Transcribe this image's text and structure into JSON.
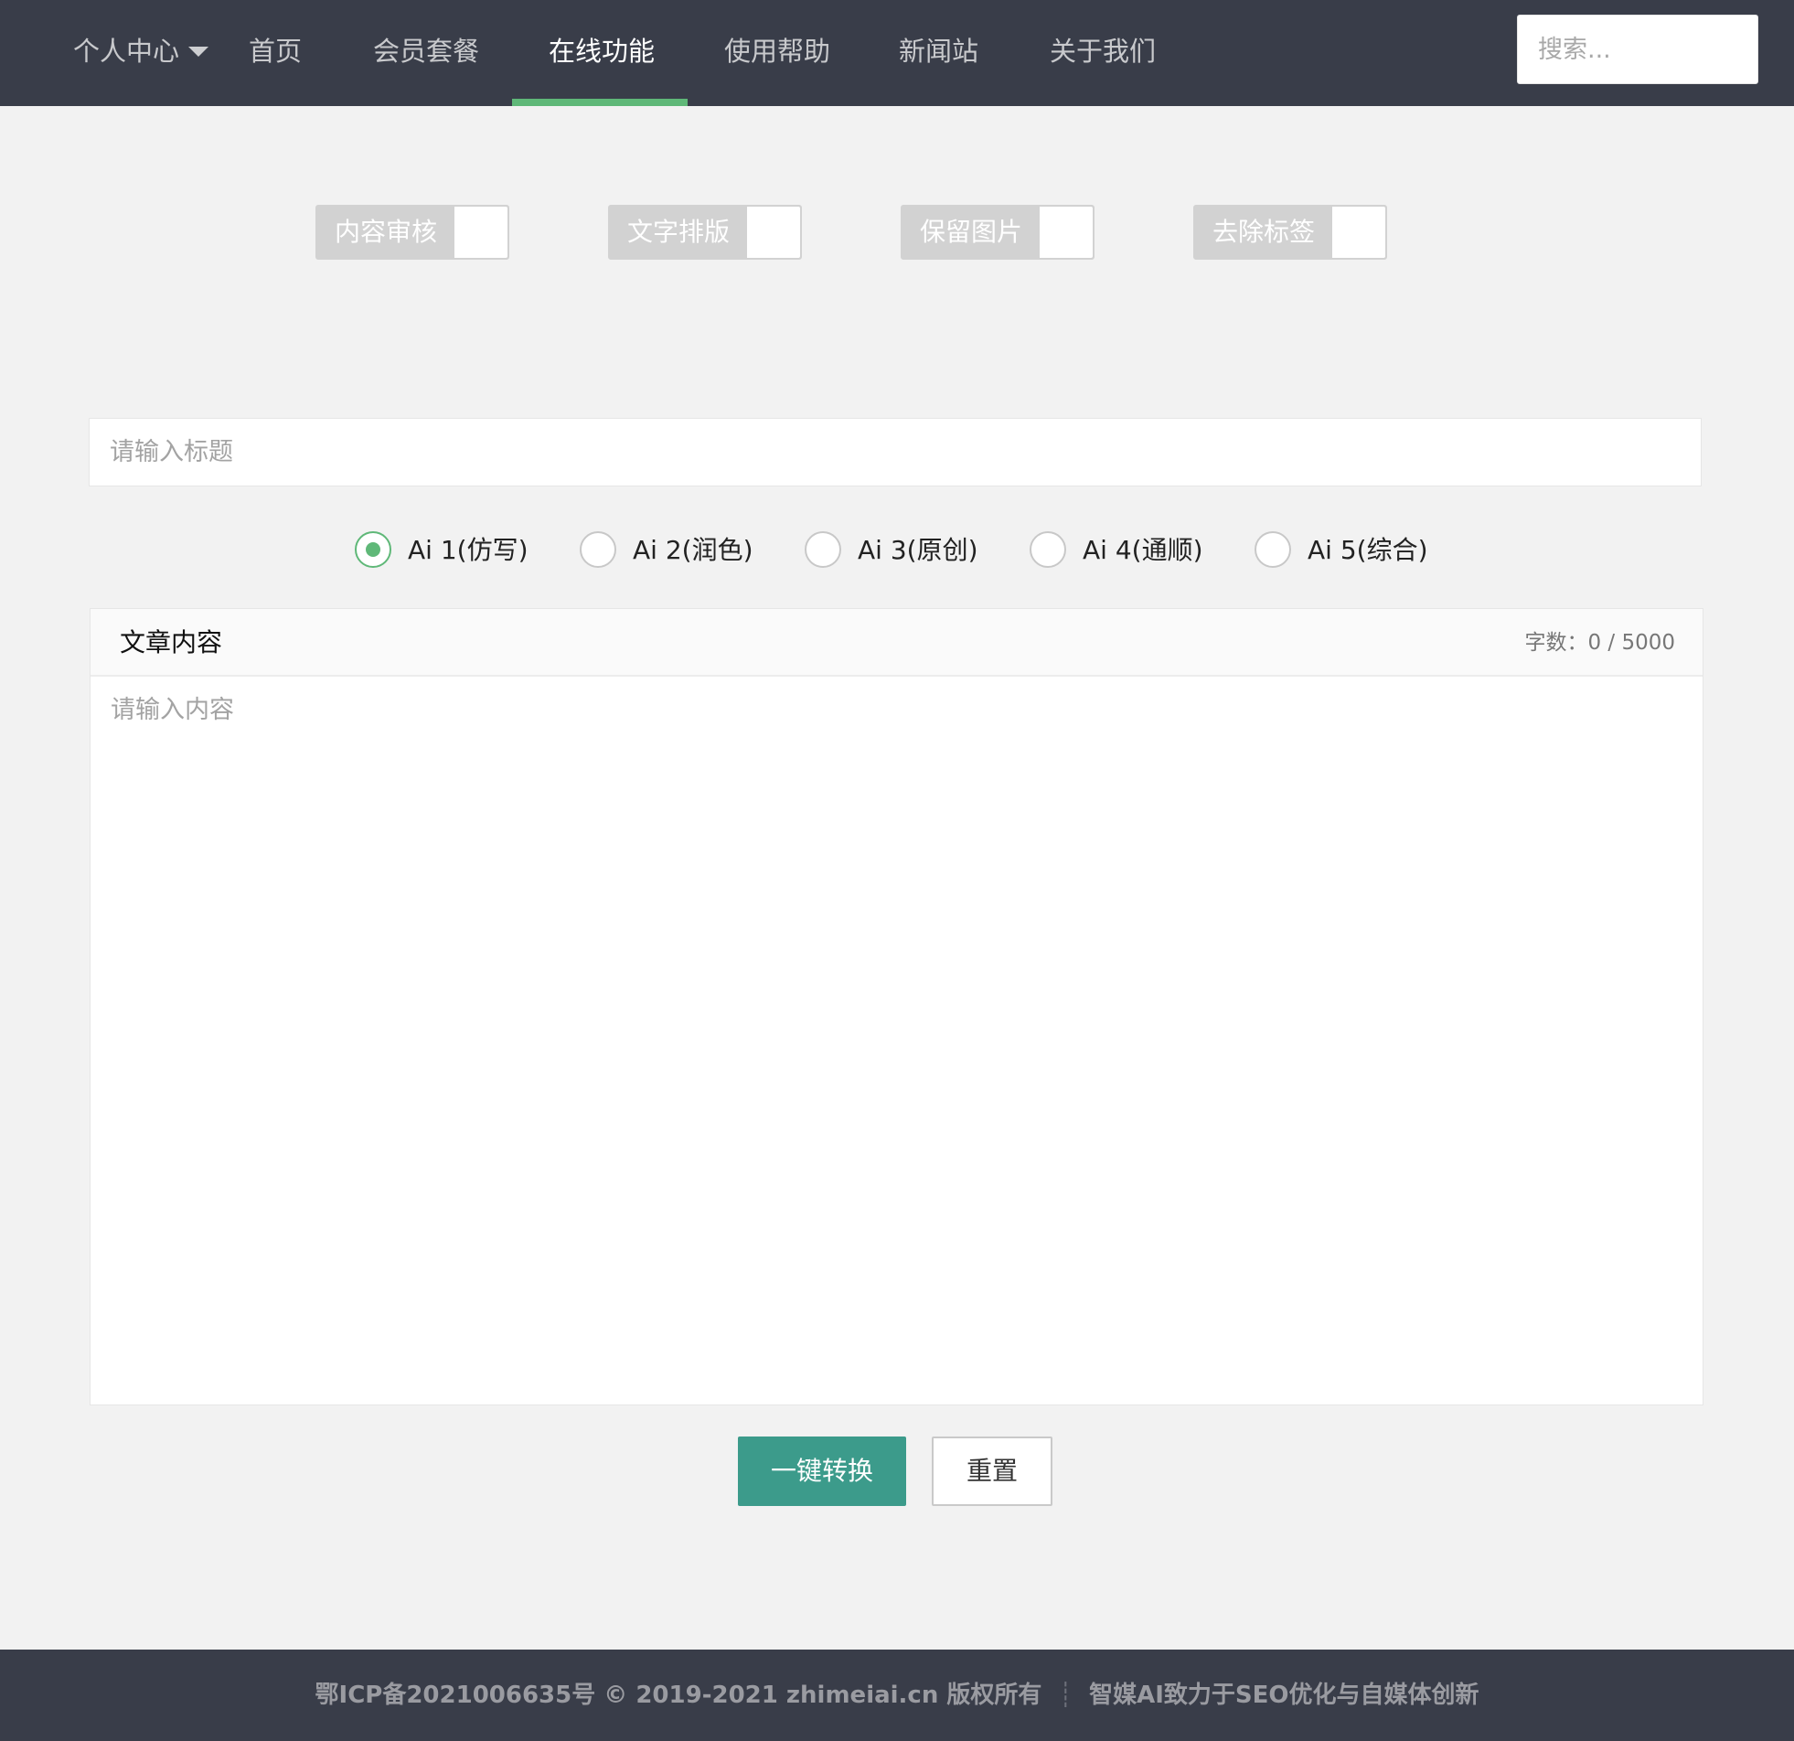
{
  "nav": {
    "items": [
      {
        "label": "个人中心",
        "has_caret": true
      },
      {
        "label": "首页"
      },
      {
        "label": "会员套餐"
      },
      {
        "label": "在线功能",
        "active": true
      },
      {
        "label": "使用帮助"
      },
      {
        "label": "新闻站"
      },
      {
        "label": "关于我们"
      }
    ],
    "search_placeholder": "搜索..."
  },
  "switches": [
    {
      "label": "内容审核",
      "on": false
    },
    {
      "label": "文字排版",
      "on": false
    },
    {
      "label": "保留图片",
      "on": false
    },
    {
      "label": "去除标签",
      "on": false
    }
  ],
  "title_input": {
    "placeholder": "请输入标题",
    "value": ""
  },
  "ai_modes": {
    "selected_index": 0,
    "options": [
      "Ai 1(仿写)",
      "Ai 2(润色)",
      "Ai 3(原创)",
      "Ai 4(通顺)",
      "Ai 5(综合)"
    ]
  },
  "article": {
    "header": "文章内容",
    "word_count": "字数：0 / 5000",
    "placeholder": "请输入内容",
    "value": ""
  },
  "buttons": {
    "convert": "一键转换",
    "reset": "重置"
  },
  "footer": {
    "left": "鄂ICP备2021006635号 © 2019-2021 zhimeiai.cn 版权所有",
    "separator": "┊",
    "right": "智媒AI致力于SEO优化与自媒体创新"
  },
  "colors": {
    "header_bg": "#393d49",
    "accent": "#5fb878",
    "primary_button": "#3c9b8b",
    "page_bg": "#f2f2f2"
  }
}
